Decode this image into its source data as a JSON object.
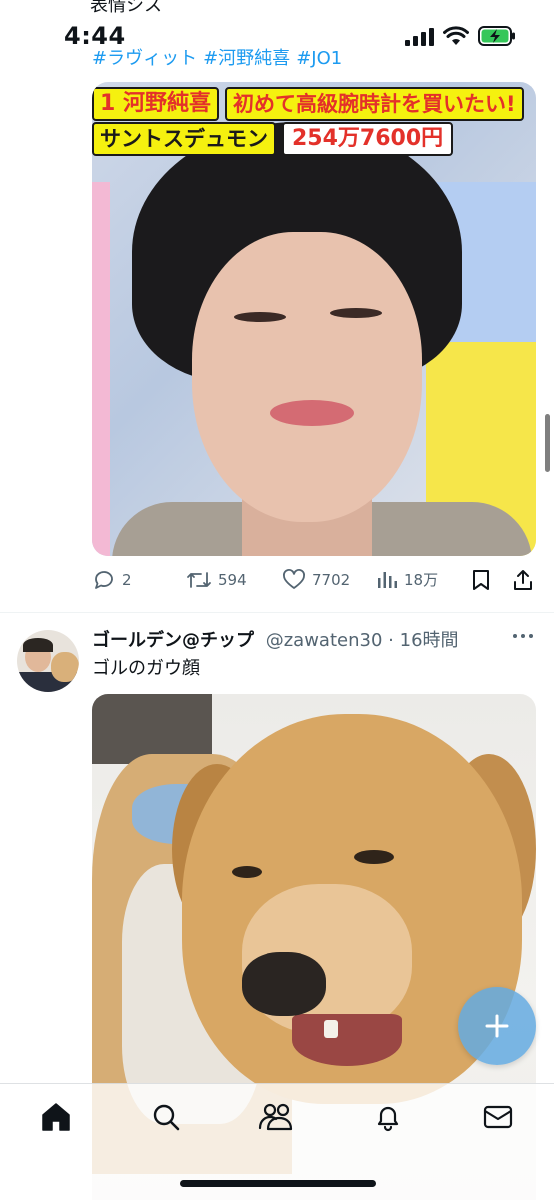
{
  "status_bar": {
    "time": "4:44",
    "partial_top_text": "表情シス"
  },
  "tweet1": {
    "hashtags": [
      "#ラヴィット",
      "#河野純喜",
      "#JO1"
    ],
    "image_caption": {
      "number_name": "1 河野純喜",
      "headline": "初めて高級腕時計を買いたい!",
      "brand": "サントスデュモン",
      "price": "254万7600円"
    },
    "actions": {
      "replies": "2",
      "retweets": "594",
      "likes": "7702",
      "views": "18万"
    }
  },
  "tweet2": {
    "display_name": "ゴールデン@チップ",
    "handle": "@zawaten30",
    "separator": "·",
    "time_ago": "16時間",
    "text": "ゴルのガウ顔"
  },
  "colors": {
    "accent": "#1d9bf0",
    "text_primary": "#0f1419",
    "text_secondary": "#536471",
    "fab": "#64aae1"
  },
  "icons": {
    "tabs": [
      "home-icon",
      "search-icon",
      "communities-icon",
      "notifications-icon",
      "messages-icon"
    ],
    "actions": [
      "reply-icon",
      "retweet-icon",
      "like-icon",
      "views-icon",
      "bookmark-icon",
      "share-icon"
    ]
  }
}
